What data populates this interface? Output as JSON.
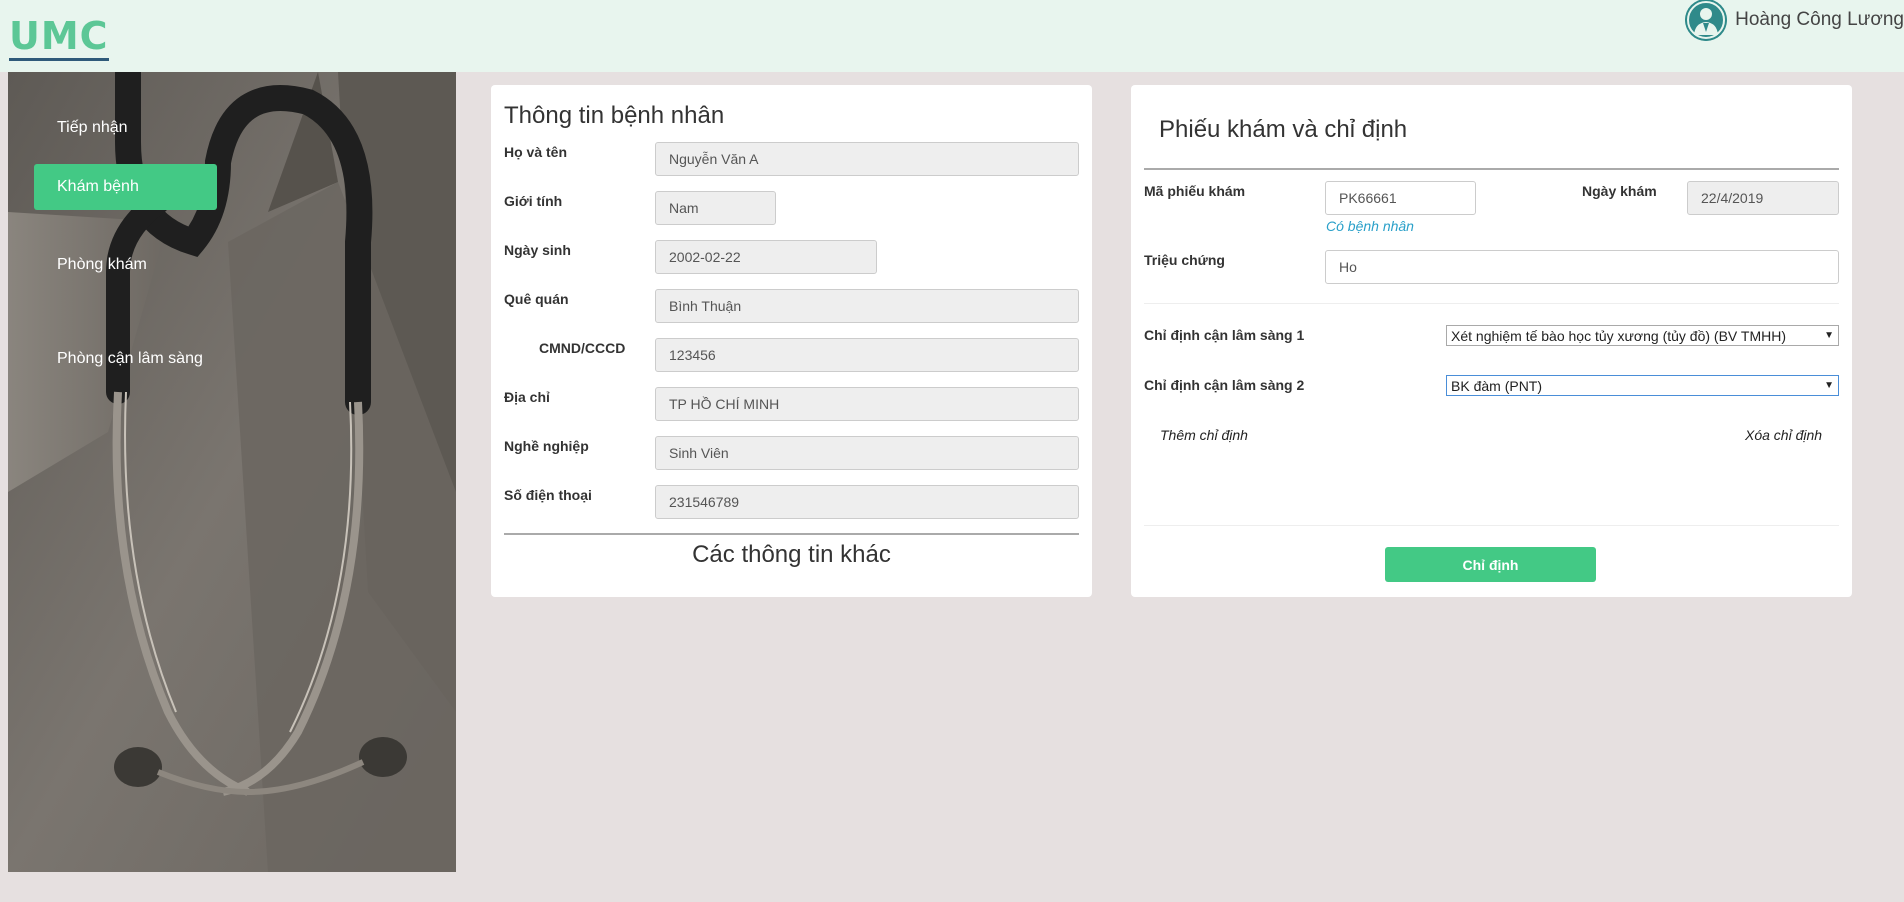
{
  "header": {
    "logo": "UMC",
    "user_name": "Hoàng Công Lương"
  },
  "sidebar": {
    "items": [
      {
        "label": "Tiếp nhận",
        "active": false
      },
      {
        "label": "Khám bệnh",
        "active": true
      },
      {
        "label": "Phòng khám",
        "active": false
      },
      {
        "label": "Phòng cận lâm sàng",
        "active": false
      }
    ]
  },
  "patient": {
    "title": "Thông tin bệnh nhân",
    "fields": [
      {
        "label": "Họ và tên",
        "value": "Nguyễn Văn A"
      },
      {
        "label": "Giới tính",
        "value": "Nam"
      },
      {
        "label": "Ngày sinh",
        "value": "2002-02-22"
      },
      {
        "label": "Quê quán",
        "value": "Bình Thuận"
      },
      {
        "label": "CMND/CCCD",
        "value": "123456"
      },
      {
        "label": "Địa chỉ",
        "value": "TP HỒ CHÍ MINH"
      },
      {
        "label": "Nghề nghiệp",
        "value": "Sinh Viên"
      },
      {
        "label": "Số điện thoại",
        "value": "231546789"
      }
    ],
    "more_info": "Các thông tin khác"
  },
  "exam": {
    "title": "Phiếu khám và chỉ định",
    "ma_phieu_label": "Mã phiếu khám",
    "ma_phieu_value": "PK66661",
    "ma_phieu_hint": "Có bệnh nhân",
    "ngay_kham_label": "Ngày khám",
    "ngay_kham_value": "22/4/2019",
    "trieu_chung_label": "Triệu chứng",
    "trieu_chung_value": "Ho",
    "chi_dinh_1_label": "Chỉ định cận lâm sàng 1",
    "chi_dinh_1_value": "Xét nghiệm tế bào học tủy xương (tủy đồ) (BV TMHH)",
    "chi_dinh_2_label": "Chỉ định cận lâm sàng 2",
    "chi_dinh_2_value": "BK đàm (PNT)",
    "add_label": "Thêm chỉ định",
    "remove_label": "Xóa chỉ định",
    "submit_label": "Chỉ định"
  },
  "colors": {
    "accent": "#43c985",
    "header_bg": "#e8f5ee",
    "page_bg": "#e6e0e0",
    "link": "#2aa0c9"
  }
}
